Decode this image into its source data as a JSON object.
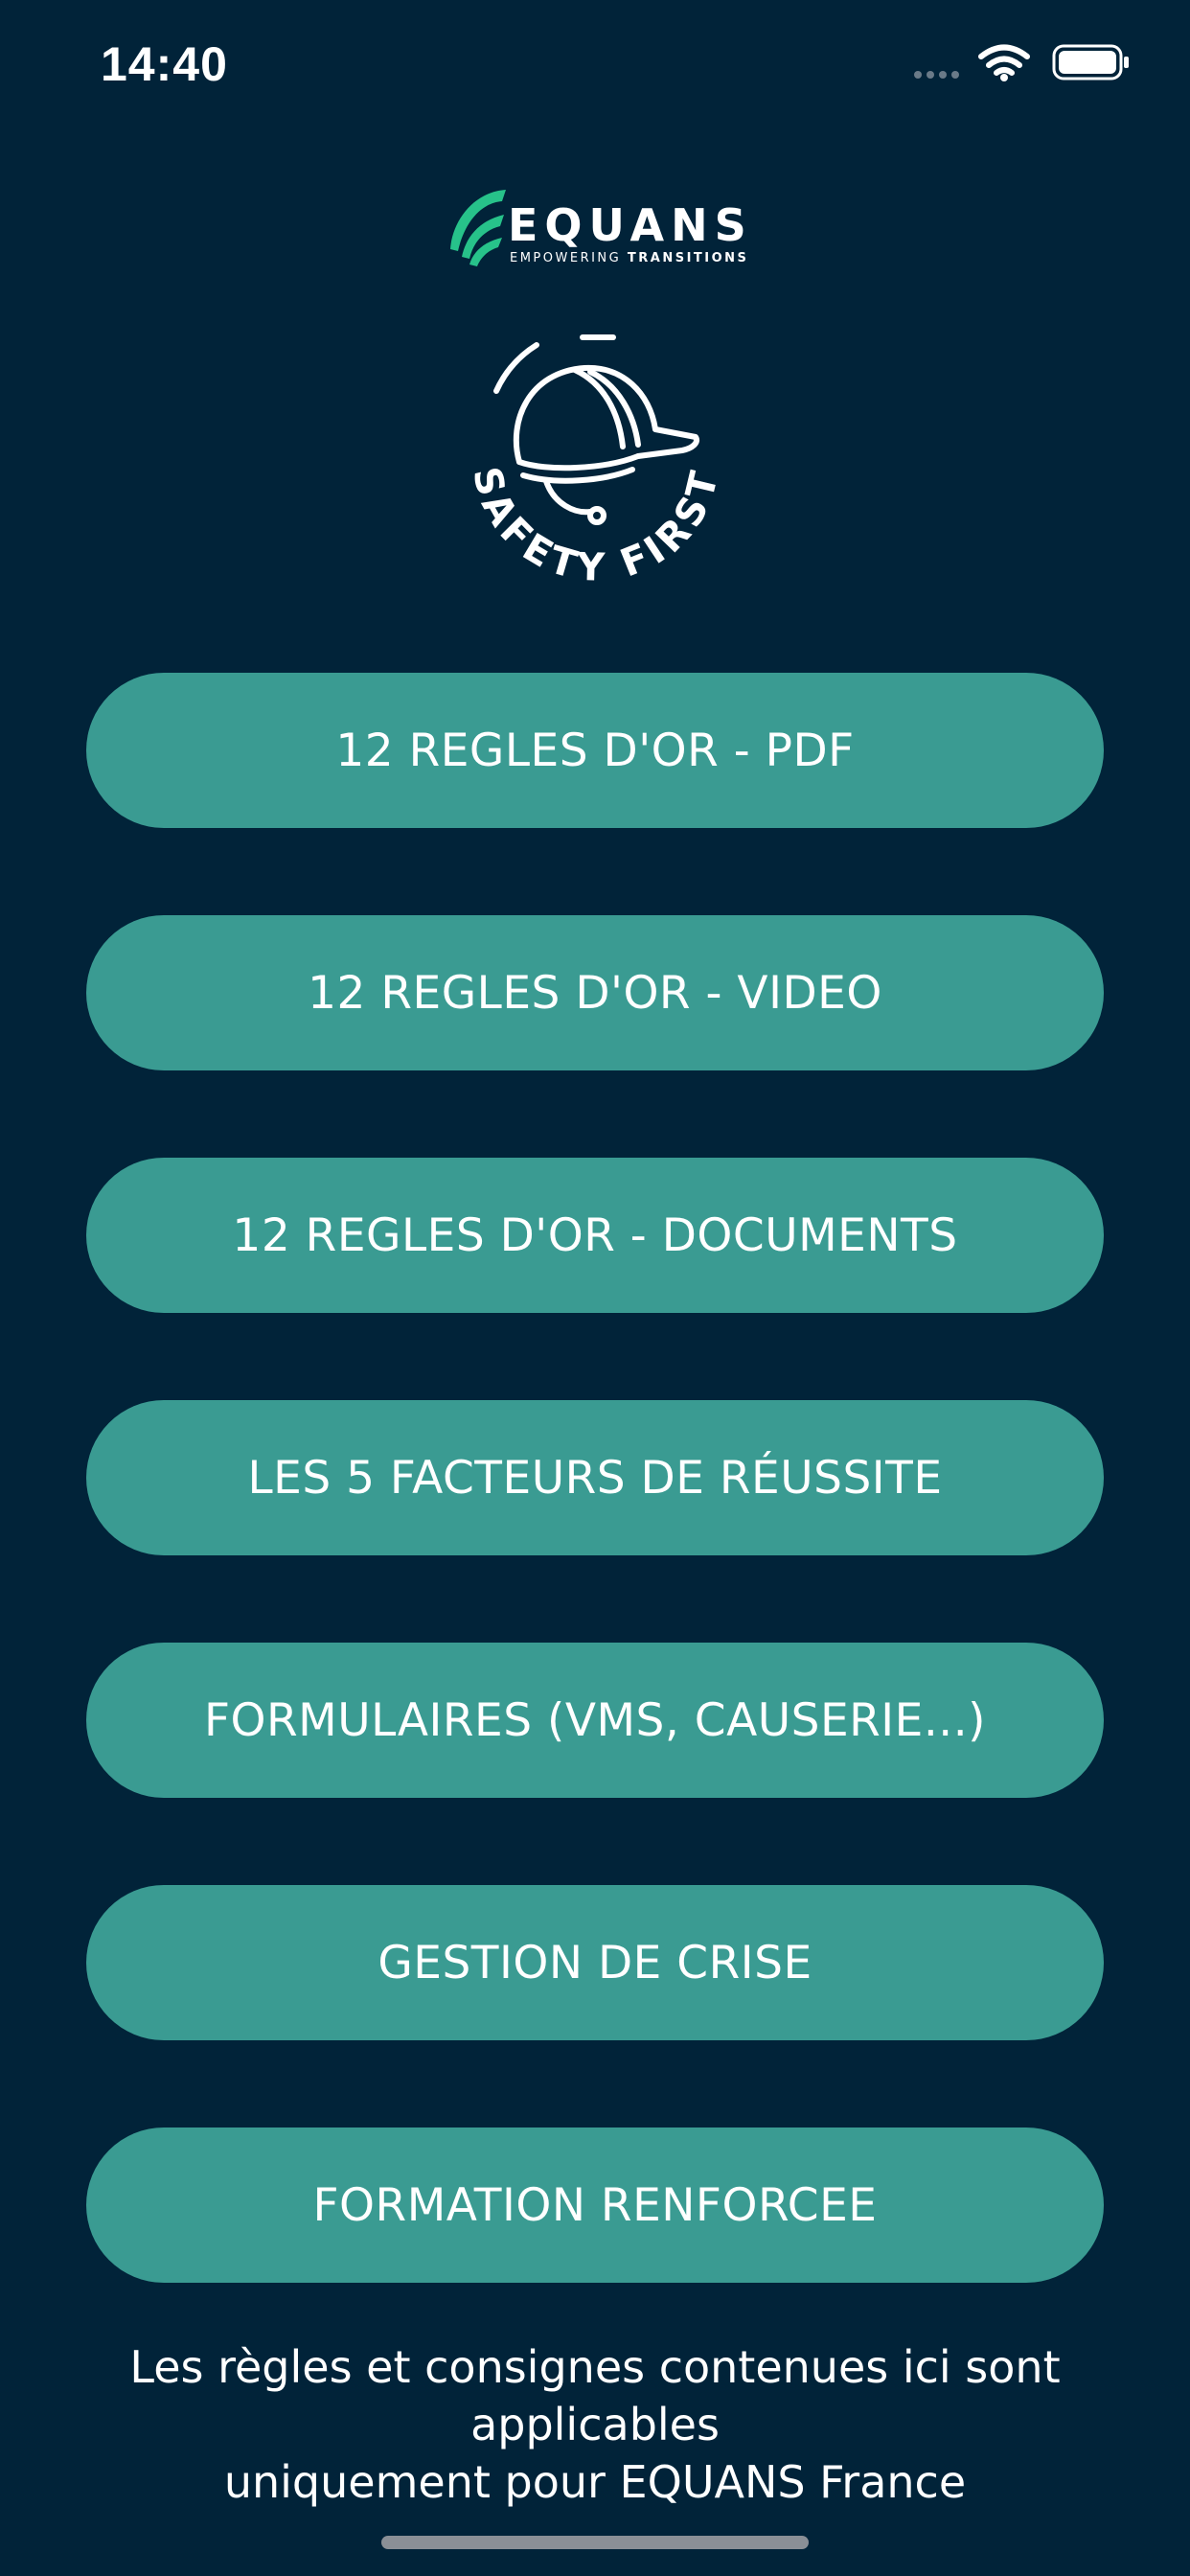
{
  "status_bar": {
    "time": "14:40",
    "icons": [
      "signal-dots-icon",
      "wifi-icon",
      "battery-icon"
    ]
  },
  "brand": {
    "logo_name": "EQUANS",
    "tagline_part1": "EMPOWERING",
    "tagline_part2": "TRANSITIONS",
    "badge_text": "SAFETY FIRST",
    "colors": {
      "background": "#012339",
      "button": "#3a9b92",
      "logo_green": "#27c28a"
    }
  },
  "menu": {
    "items": [
      {
        "label": "12 REGLES D'OR - PDF"
      },
      {
        "label": "12 REGLES D'OR - VIDEO"
      },
      {
        "label": "12 REGLES D'OR - DOCUMENTS"
      },
      {
        "label": "LES 5 FACTEURS DE RÉUSSITE"
      },
      {
        "label": "FORMULAIRES (VMS, CAUSERIE...)"
      },
      {
        "label": "GESTION DE CRISE"
      },
      {
        "label": "FORMATION RENFORCEE"
      }
    ]
  },
  "footer": {
    "line1": "Les règles et consignes contenues ici sont applicables",
    "line2": "uniquement pour EQUANS France"
  }
}
